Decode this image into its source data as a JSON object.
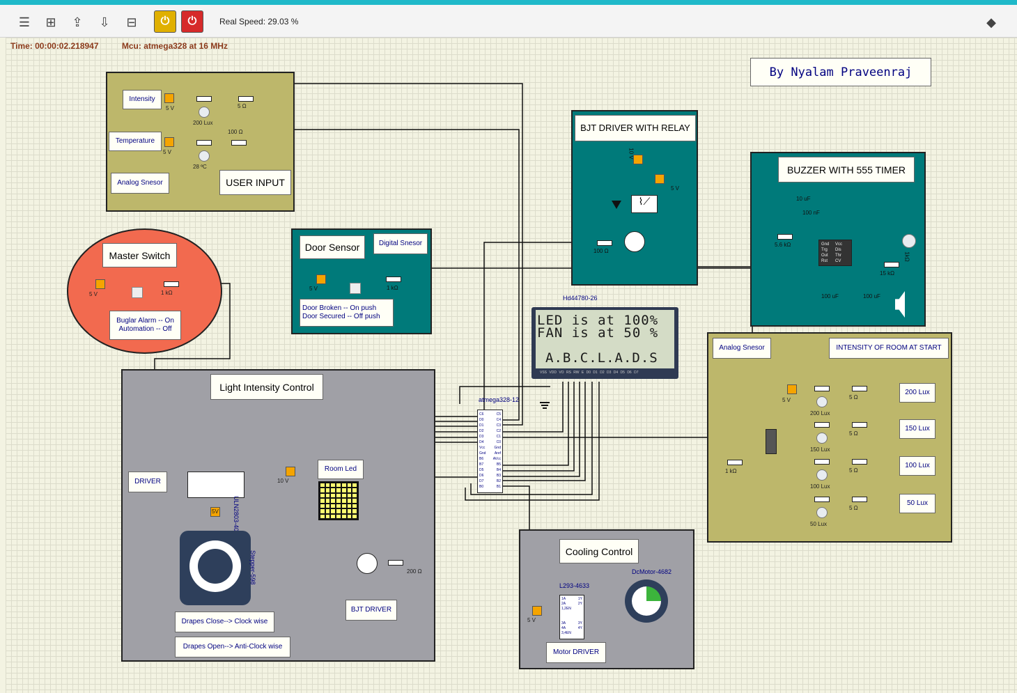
{
  "toolbar": {
    "speed": "Real Speed: 29.03 %",
    "icons": [
      "config-icon",
      "new-circuit-icon",
      "open-icon",
      "save-icon",
      "save-as-icon",
      "pause-icon",
      "power-icon",
      "info-icon"
    ]
  },
  "status": {
    "time": "Time: 00:00:02.218947",
    "mcu": "Mcu: atmega328 at 16 MHz"
  },
  "author": "By Nyalam Praveenraj",
  "user_input": {
    "intensity": "Intensity",
    "temperature": "Temperature",
    "analog": "Analog Snesor",
    "title": "USER INPUT",
    "v1": "5 V",
    "v2": "5 V",
    "lux": "200 Lux",
    "temp": "28 ºC",
    "r1": "5 Ω",
    "r2": "100 Ω"
  },
  "master": {
    "title": "Master Switch",
    "desc": "Buglar Alarm -- On\nAutomation -- Off",
    "v": "5 V",
    "r": "1 kΩ"
  },
  "door": {
    "title": "Door Sensor",
    "type": "Digital Snesor",
    "desc": "Door Broken -- On push\nDoor Secured -- Off push",
    "v": "5 V",
    "r": "1 kΩ"
  },
  "bjt_relay": {
    "title": "BJT DRIVER WITH RELAY",
    "v10": "10 V",
    "v5": "5 V",
    "r": "100 Ω"
  },
  "buzzer": {
    "title": "BUZZER WITH 555 TIMER",
    "c1": "10 uF",
    "c2": "100 nF",
    "r1": "5.6 kΩ",
    "r2": "15 kΩ",
    "c3": "100 uF",
    "c4": "100 uF",
    "pins": [
      "Gnd",
      "Vcc",
      "Trg",
      "Dis",
      "Out",
      "Thr",
      "Rst",
      "CV"
    ],
    "pot": "1kΩ"
  },
  "lcd": {
    "name": "Hd44780-26",
    "line1": "LED is at 100%",
    "line2": "FAN is at 50 %",
    "line3": "A.B.C.L.A.D.S",
    "pins": "VSS VDD VO RS RW E D0 D1 D2 D3 D4 D5 D6 D7"
  },
  "mcu": {
    "name": "atmega328-12",
    "left": [
      "C6",
      "D0",
      "D1",
      "D2",
      "D3",
      "D4",
      "Vcc",
      "Gnd",
      "B6",
      "B7",
      "D5",
      "D6",
      "D7",
      "B0"
    ],
    "right": [
      "C5",
      "C4",
      "C3",
      "C2",
      "C1",
      "C0",
      "Gnd",
      "Aref",
      "AVcc",
      "B5",
      "B4",
      "B3",
      "B2",
      "B1"
    ]
  },
  "analog2": {
    "title": "Analog Snesor",
    "intensity": "INTENSITY OF ROOM AT START",
    "lux": [
      "200 Lux",
      "150 Lux",
      "100 Lux",
      "50 Lux"
    ],
    "r": "5 Ω",
    "v": "5 V",
    "r1k": "1 kΩ"
  },
  "light": {
    "title": "Light Intensity Control",
    "driver": "DRIVER",
    "uln": "ULN2803-404",
    "v10": "10 V",
    "room": "Room Led",
    "bjt": "BJT DRIVER",
    "r": "200 Ω",
    "stepper": "Stepper-598",
    "close": "Drapes Close--> Clock wise",
    "open": "Drapes Open--> Anti-Clock wise",
    "v5": "5V"
  },
  "cooling": {
    "title": "Cooling Control",
    "chip": "L293-4633",
    "motor": "DcMotor-4682",
    "v": "5 V",
    "driver": "Motor DRIVER",
    "pins": [
      "1A",
      "2A",
      "1,2EN",
      "",
      "",
      "3A",
      "4A",
      "3,4EN"
    ],
    "rpins": [
      "1Y",
      "2Y",
      "",
      "",
      "",
      "3Y",
      "4Y",
      ""
    ]
  },
  "colors": {
    "olive": "#bdb76b",
    "teal": "#007a7a",
    "grey": "#a0a0a6",
    "master": "#f26a4f"
  }
}
